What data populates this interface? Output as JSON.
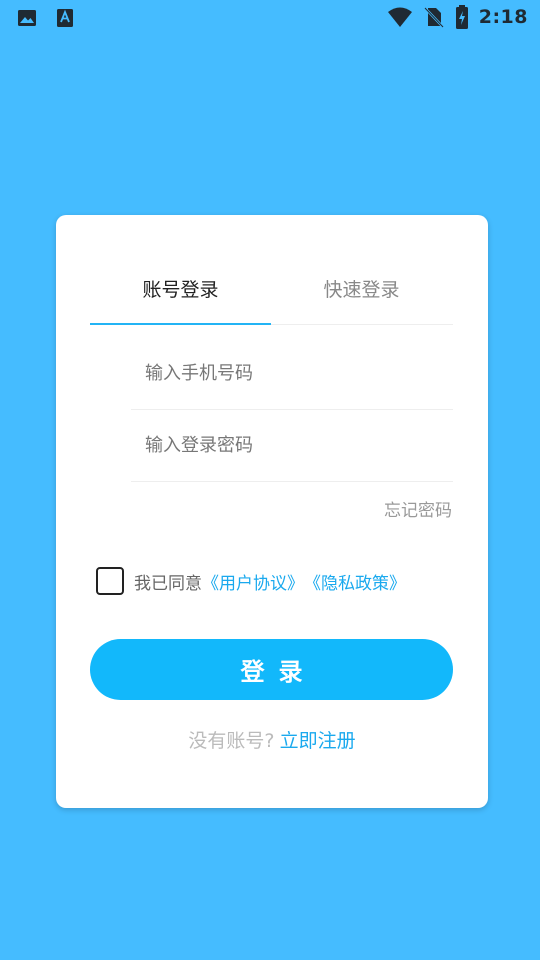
{
  "status_bar": {
    "time": "2:18",
    "icons_left": [
      "image-icon",
      "text-a-icon"
    ],
    "icons_right": [
      "wifi-icon",
      "no-sim-icon",
      "battery-charging-icon"
    ]
  },
  "login": {
    "tabs": [
      {
        "label": "账号登录",
        "active": true
      },
      {
        "label": "快速登录",
        "active": false
      }
    ],
    "phone_placeholder": "输入手机号码",
    "password_placeholder": "输入登录密码",
    "forgot_password": "忘记密码",
    "agree_text": "我已同意",
    "user_agreement": "《用户协议》",
    "privacy_policy": "《隐私政策》",
    "login_button": "登录",
    "no_account_text": "没有账号?",
    "register_link": "立即注册"
  },
  "colors": {
    "background": "#45bcff",
    "accent": "#12b8fb",
    "link": "#1aa9ee"
  }
}
